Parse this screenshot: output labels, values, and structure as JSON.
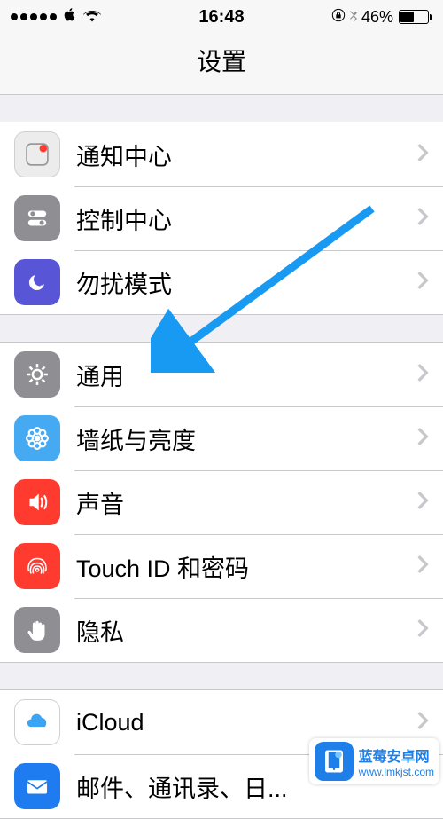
{
  "status": {
    "time": "16:48",
    "battery_pct": "46%"
  },
  "nav": {
    "title": "设置"
  },
  "groups": [
    {
      "rows": [
        {
          "id": "notifications",
          "label": "通知中心",
          "icon": "notification-icon",
          "bg": "#ececec",
          "fg": "#ff3b30"
        },
        {
          "id": "control-center",
          "label": "控制中心",
          "icon": "switches-icon",
          "bg": "#8e8e93",
          "fg": "#fff"
        },
        {
          "id": "dnd",
          "label": "勿扰模式",
          "icon": "moon-icon",
          "bg": "#5856d6",
          "fg": "#fff"
        }
      ]
    },
    {
      "rows": [
        {
          "id": "general",
          "label": "通用",
          "icon": "gear-icon",
          "bg": "#8e8e93",
          "fg": "#fff"
        },
        {
          "id": "wallpaper",
          "label": "墙纸与亮度",
          "icon": "flower-icon",
          "bg": "#45aaf2",
          "fg": "#fff"
        },
        {
          "id": "sounds",
          "label": "声音",
          "icon": "speaker-icon",
          "bg": "#ff3b30",
          "fg": "#fff"
        },
        {
          "id": "touchid",
          "label": "Touch ID 和密码",
          "icon": "fingerprint-icon",
          "bg": "#ff3b30",
          "fg": "#fff"
        },
        {
          "id": "privacy",
          "label": "隐私",
          "icon": "hand-icon",
          "bg": "#8e8e93",
          "fg": "#fff"
        }
      ]
    },
    {
      "rows": [
        {
          "id": "icloud",
          "label": "iCloud",
          "icon": "cloud-icon",
          "bg": "#ffffff",
          "fg": "#3aa4f5",
          "border": true
        },
        {
          "id": "mail",
          "label": "邮件、通讯录、日...",
          "icon": "mail-icon",
          "bg": "#1f7cf0",
          "fg": "#fff"
        }
      ]
    }
  ],
  "annotation": {
    "arrow_color": "#189af2"
  },
  "watermark": {
    "title": "蓝莓安卓网",
    "url": "www.lmkjst.com"
  }
}
